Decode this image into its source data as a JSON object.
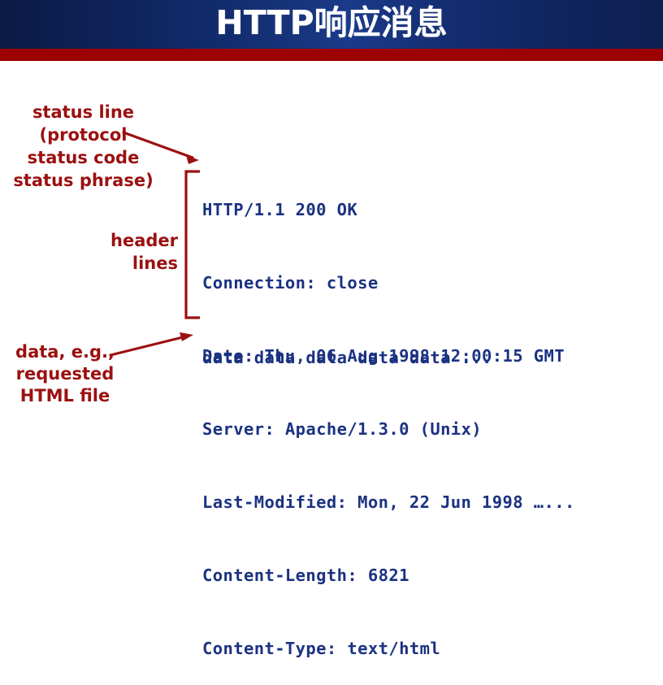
{
  "slide": {
    "title": "HTTP响应消息",
    "header_gradient_start": "#0b1a46",
    "header_gradient_mid": "#1a3a8a",
    "header_gradient_end": "#0d1f52",
    "accent_bar_color": "#9d0000",
    "background_color": "#ffffff"
  },
  "annotations": {
    "accent_color": "#9b1010",
    "status_line": "status line\n(protocol\nstatus code\nstatus phrase)",
    "header_lines": "header\nlines",
    "data": "data, e.g.,\nrequested\nHTML file"
  },
  "response": {
    "text_color": "#1b3281",
    "status_line": "HTTP/1.1 200 OK",
    "header_lines": [
      "Connection: close",
      "Date: Thu, 06 Aug 1998 12:00:15 GMT",
      "Server: Apache/1.3.0 (Unix)",
      "Last-Modified: Mon, 22 Jun 1998 …...",
      "Content-Length: 6821",
      "Content-Type: text/html"
    ],
    "body_line": "data data data data data ..."
  }
}
